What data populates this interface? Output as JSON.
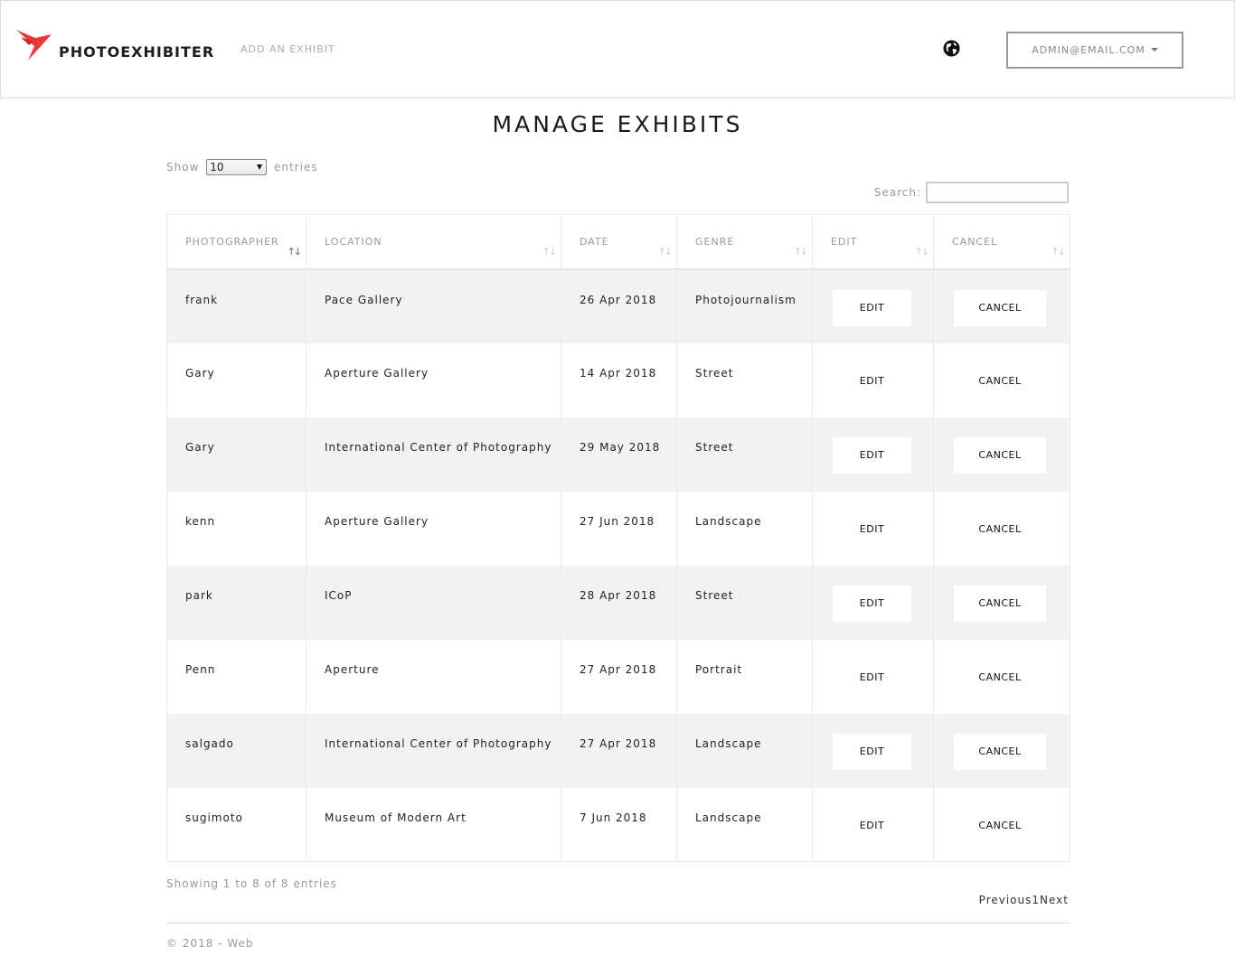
{
  "header": {
    "brand": "PHOTOEXHIBITER",
    "nav_add": "ADD AN EXHIBIT",
    "user_email": "ADMIN@EMAIL.COM",
    "brand_color": "#e8393a"
  },
  "main": {
    "title": "MANAGE EXHIBITS",
    "show_label": "Show",
    "entries_value": "10",
    "entries_label": "entries",
    "search_label": "Search:",
    "search_value": ""
  },
  "table": {
    "columns": [
      "PHOTOGRAPHER",
      "LOCATION",
      "DATE",
      "GENRE",
      "EDIT",
      "CANCEL"
    ],
    "edit_label": "EDIT",
    "cancel_label": "CANCEL",
    "rows": [
      {
        "photographer": "frank",
        "location": "Pace Gallery",
        "date": "26 Apr 2018",
        "genre": "Photojournalism"
      },
      {
        "photographer": "Gary",
        "location": "Aperture Gallery",
        "date": "14 Apr 2018",
        "genre": "Street"
      },
      {
        "photographer": "Gary",
        "location": "International Center of Photography",
        "date": "29 May 2018",
        "genre": "Street"
      },
      {
        "photographer": "kenn",
        "location": "Aperture Gallery",
        "date": "27 Jun 2018",
        "genre": "Landscape"
      },
      {
        "photographer": "park",
        "location": "ICoP",
        "date": "28 Apr 2018",
        "genre": "Street"
      },
      {
        "photographer": "Penn",
        "location": "Aperture",
        "date": "27 Apr 2018",
        "genre": "Portrait"
      },
      {
        "photographer": "salgado",
        "location": "International Center of Photography",
        "date": "27 Apr 2018",
        "genre": "Landscape"
      },
      {
        "photographer": "sugimoto",
        "location": "Museum of Modern Art",
        "date": "7 Jun 2018",
        "genre": "Landscape"
      }
    ]
  },
  "info": "Showing 1 to 8 of 8 entries",
  "pagination": {
    "previous": "Previous",
    "page": "1",
    "next": "Next"
  },
  "footer": "© 2018 - Web"
}
